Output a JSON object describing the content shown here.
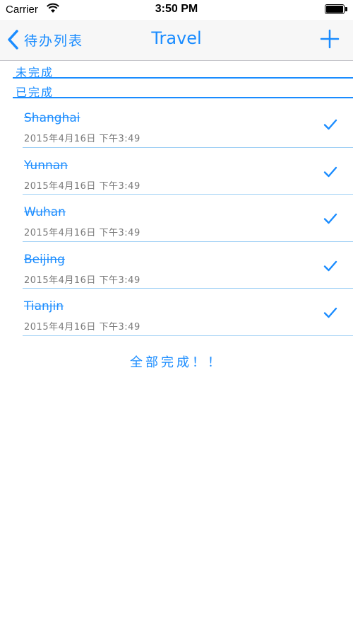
{
  "status_bar": {
    "carrier": "Carrier",
    "time": "3:50 PM"
  },
  "nav": {
    "back_label": "待办列表",
    "title": "Travel"
  },
  "sections": {
    "incomplete": "未完成",
    "complete": "已完成"
  },
  "tasks": [
    {
      "name": "Shanghai",
      "date": "2015年4月16日 下午3:49"
    },
    {
      "name": "Yunnan",
      "date": "2015年4月16日 下午3:49"
    },
    {
      "name": "Wuhan",
      "date": "2015年4月16日 下午3:49"
    },
    {
      "name": "Beijing",
      "date": "2015年4月16日 下午3:49"
    },
    {
      "name": "Tianjin",
      "date": "2015年4月16日 下午3:49"
    }
  ],
  "footer_message": "全部完成！！",
  "colors": {
    "accent": "#1a8cff",
    "separator": "#9fd0f5",
    "secondary_text": "#7a7a7a"
  }
}
